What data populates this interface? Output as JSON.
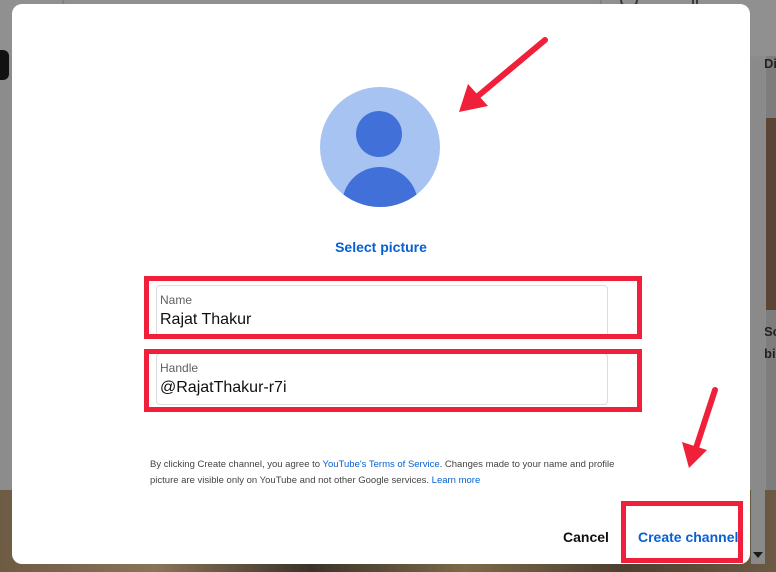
{
  "dialog": {
    "select_picture": "Select picture",
    "name_field": {
      "label": "Name",
      "value": "Rajat Thakur"
    },
    "handle_field": {
      "label": "Handle",
      "value": "@RajatThakur-r7i"
    },
    "terms": {
      "part1": "By clicking Create channel, you agree to ",
      "tos_link": "YouTube's Terms of Service",
      "part2": ". Changes made to your name and profile picture are visible only on YouTube and not other Google services. ",
      "learn_more": "Learn more"
    },
    "buttons": {
      "cancel": "Cancel",
      "create": "Create channel"
    }
  },
  "colors": {
    "accent": "#065fd4",
    "annotation": "#f01f3a",
    "avatar_bg": "#a7c3f2",
    "avatar_fg": "#4170d9"
  },
  "background": {
    "edge_text_1": "Di",
    "edge_text_2": "Sc",
    "edge_text_3": "bi"
  }
}
